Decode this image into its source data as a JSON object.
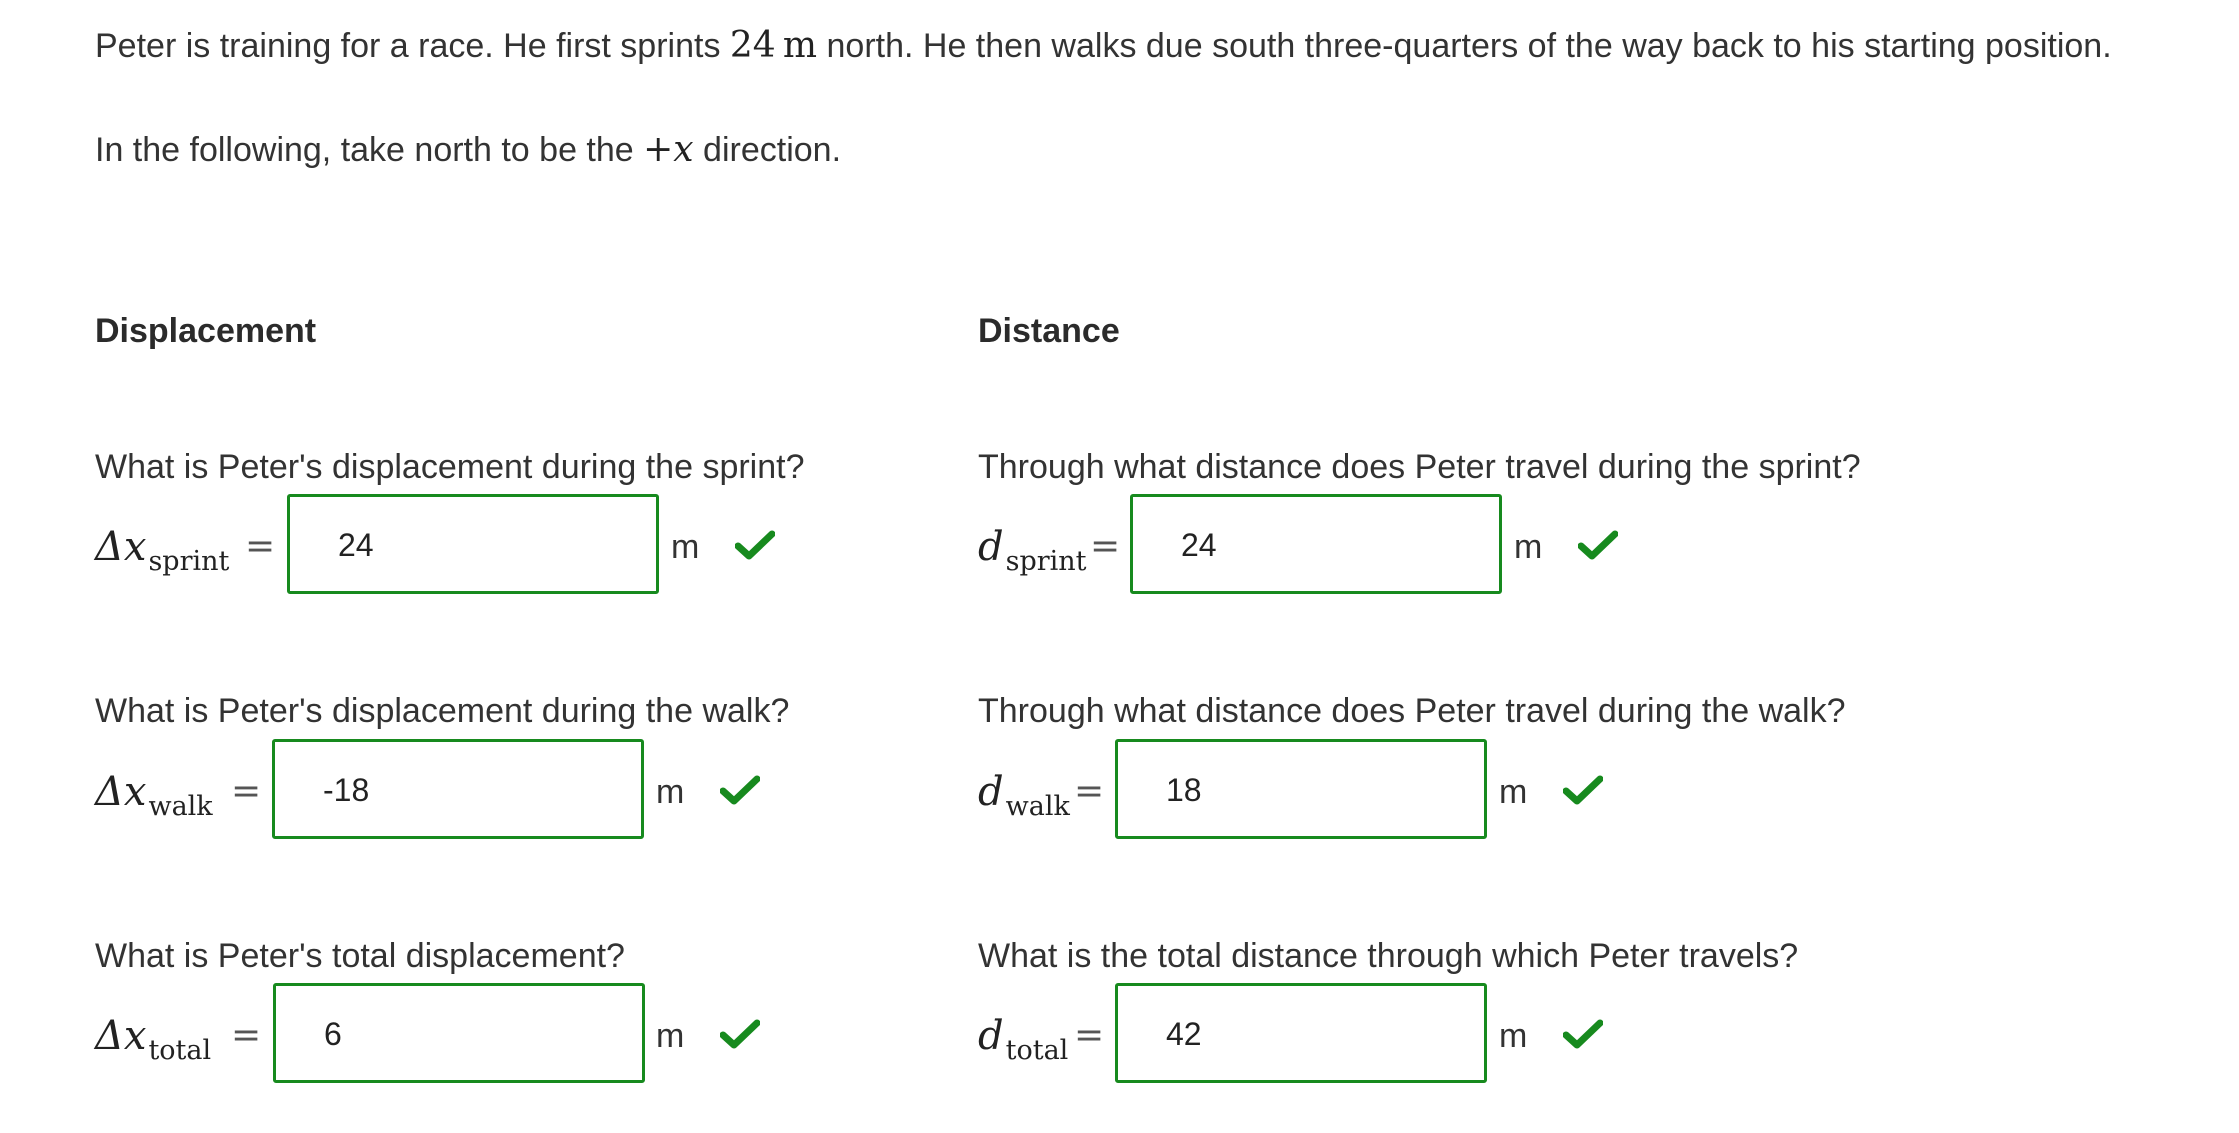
{
  "intro": {
    "line1_a": "Peter is training for a race. He first sprints ",
    "line1_num": "24",
    "line1_unit": "m",
    "line1_b": " north. He then walks due south three-quarters of the way back to his starting position.",
    "line2_a": "In the following, take north to be the ",
    "line2_var": "+x",
    "line2_b": " direction."
  },
  "displacement": {
    "title": "Displacement",
    "items": [
      {
        "question": "What is Peter's displacement during the sprint?",
        "symbol": "Δx",
        "sub": "sprint",
        "value": "24",
        "unit": "m"
      },
      {
        "question": "What is Peter's displacement during the walk?",
        "symbol": "Δx",
        "sub": "walk",
        "value": "-18",
        "unit": "m"
      },
      {
        "question": "What is Peter's total displacement?",
        "symbol": "Δx",
        "sub": "total",
        "value": "6",
        "unit": "m"
      }
    ]
  },
  "distance": {
    "title": "Distance",
    "items": [
      {
        "question": "Through what distance does Peter travel during the sprint?",
        "symbol": "d",
        "sub": "sprint",
        "value": "24",
        "unit": "m"
      },
      {
        "question": "Through what distance does Peter travel during the walk?",
        "symbol": "d",
        "sub": "walk",
        "value": "18",
        "unit": "m"
      },
      {
        "question": "What is the total distance through which Peter travels?",
        "symbol": "d",
        "sub": "total",
        "value": "42",
        "unit": "m"
      }
    ]
  },
  "equals_sign": "=",
  "icons": {
    "correct": "checkmark-icon"
  },
  "colors": {
    "correct": "#178a1e",
    "text": "#333333"
  }
}
